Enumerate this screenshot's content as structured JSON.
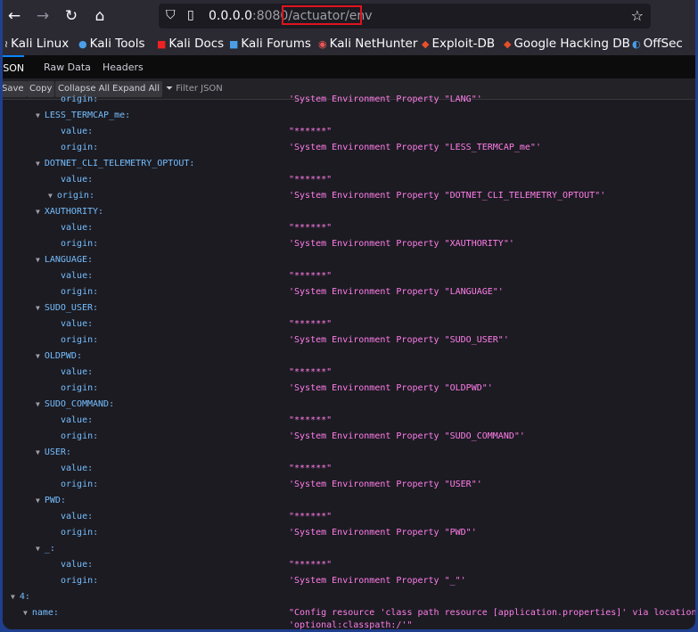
{
  "browser": {
    "url_host": "0.0.0.0",
    "url_port": ":8080/",
    "url_path": "actuator/env"
  },
  "bookmarks": [
    "Kali Linux",
    "Kali Tools",
    "Kali Docs",
    "Kali Forums",
    "Kali NetHunter",
    "Exploit-DB",
    "Google Hacking DB",
    "OffSec"
  ],
  "tabs": [
    "JSON",
    "Raw Data",
    "Headers"
  ],
  "toolbar": {
    "save": "Save",
    "copy": "Copy",
    "collapse": "Collapse All",
    "expand": "Expand All",
    "filter_placeholder": "Filter JSON"
  },
  "colors": {
    "key": "#75bfff",
    "string": "#ff7de9",
    "highlight": "#e0141e"
  },
  "top_partial": {
    "key": "origin:",
    "value": "'System Environment Property \"LANG\"'"
  },
  "entries": [
    {
      "name": "LESS_TERMCAP_me:",
      "value": "\"******\"",
      "origin": "'System Environment Property \"LESS_TERMCAP_me\"'"
    },
    {
      "name": "DOTNET_CLI_TELEMETRY_OPTOUT:",
      "value": "\"******\"",
      "origin": "'System Environment Property \"DOTNET_CLI_TELEMETRY_OPTOUT\"'"
    },
    {
      "name": "XAUTHORITY:",
      "value": "\"******\"",
      "origin": "'System Environment Property \"XAUTHORITY\"'"
    },
    {
      "name": "LANGUAGE:",
      "value": "\"******\"",
      "origin": "'System Environment Property \"LANGUAGE\"'"
    },
    {
      "name": "SUDO_USER:",
      "value": "\"******\"",
      "origin": "'System Environment Property \"SUDO_USER\"'"
    },
    {
      "name": "OLDPWD:",
      "value": "\"******\"",
      "origin": "'System Environment Property \"OLDPWD\"'"
    },
    {
      "name": "SUDO_COMMAND:",
      "value": "\"******\"",
      "origin": "'System Environment Property \"SUDO_COMMAND\"'"
    },
    {
      "name": "USER:",
      "value": "\"******\"",
      "origin": "'System Environment Property \"USER\"'"
    },
    {
      "name": "PWD:",
      "value": "\"******\"",
      "origin": "'System Environment Property \"PWD\"'"
    },
    {
      "name": "_:",
      "value": "\"******\"",
      "origin": "'System Environment Property \"_\"'"
    }
  ],
  "labels": {
    "value": "value:",
    "origin": "origin:"
  },
  "next": {
    "index": "4:",
    "key": "name:",
    "value_line1": "\"Config resource 'class path resource [application.properties]' via location",
    "value_line2": "'optional:classpath:/'\""
  }
}
